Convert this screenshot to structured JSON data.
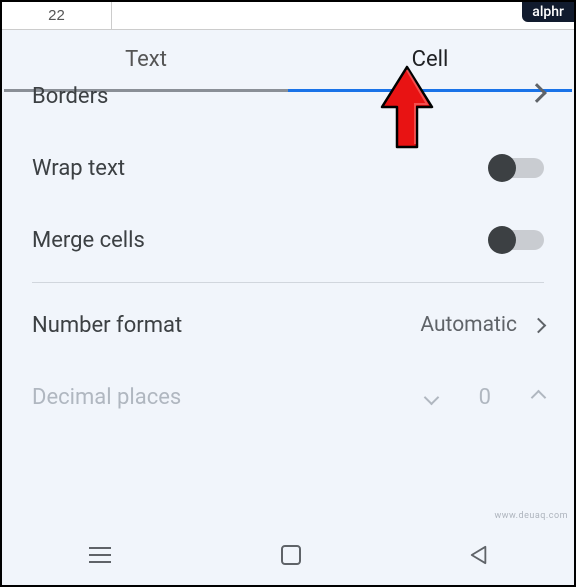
{
  "badge": "alphr",
  "spreadsheet": {
    "cell_ref": "22"
  },
  "tabs": {
    "text_label": "Text",
    "cell_label": "Cell",
    "active": "cell"
  },
  "options": {
    "borders": {
      "label": "Borders"
    },
    "wrap_text": {
      "label": "Wrap text",
      "value": false
    },
    "merge_cells": {
      "label": "Merge cells",
      "value": false
    },
    "number_format": {
      "label": "Number format",
      "value": "Automatic"
    },
    "decimal_places": {
      "label": "Decimal places",
      "value": "0",
      "enabled": false
    }
  },
  "watermark": "www.deuaq.com"
}
